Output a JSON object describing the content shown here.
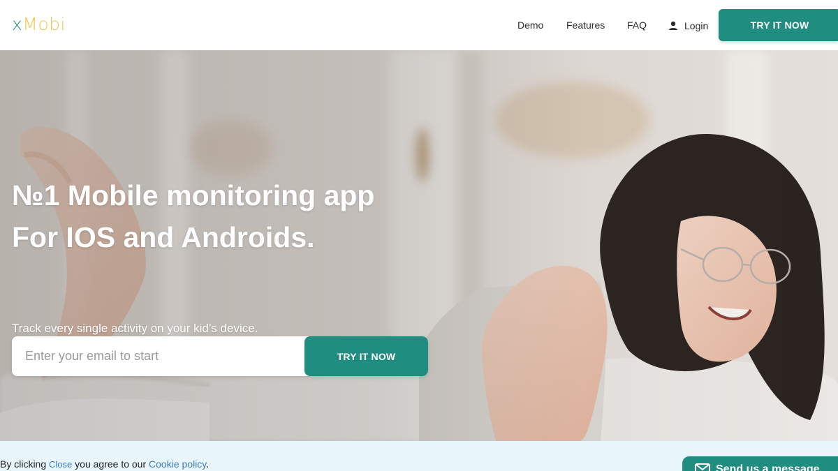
{
  "header": {
    "logo": {
      "part1": "x",
      "part2": "Mobi"
    },
    "nav": {
      "demo": "Demo",
      "features": "Features",
      "faq": "FAQ",
      "login": "Login"
    },
    "cta_label": "TRY IT NOW"
  },
  "hero": {
    "title_line1": "№1 Mobile monitoring app",
    "title_line2": "For IOS and Androids.",
    "subtitle": "Track every single activity on your kid’s device.",
    "email_placeholder": "Enter your email to start",
    "cta_label": "TRY IT NOW"
  },
  "cookie_bar": {
    "prefix": "By clicking",
    "close_label": "Close",
    "middle": "you agree to our",
    "policy_label": "Cookie policy",
    "suffix": "."
  },
  "message_widget": {
    "label": "Send us a message",
    "icon": "mail-icon"
  },
  "colors": {
    "brand_teal": "#1f8d80",
    "logo_yellow": "#f2c64a",
    "cookie_bg": "#e8f6fc",
    "link": "#3b7cc0"
  }
}
